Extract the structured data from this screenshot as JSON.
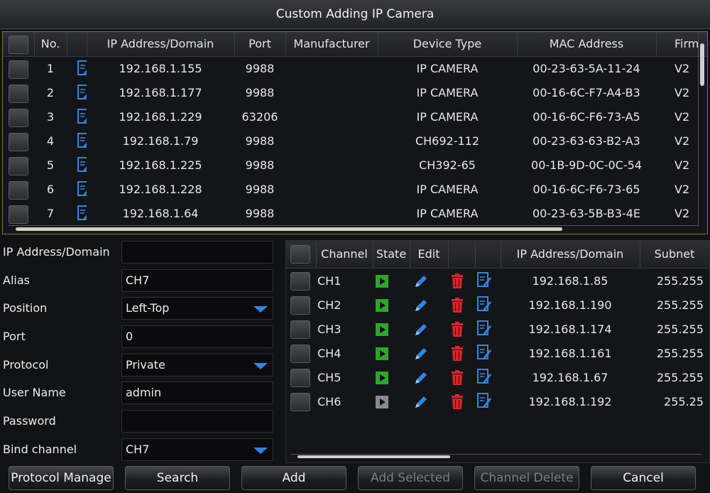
{
  "window": {
    "title": "Custom Adding IP Camera"
  },
  "device_table": {
    "columns": [
      "No.",
      "IP Address/Domain",
      "Port",
      "Manufacturer",
      "Device Type",
      "MAC Address",
      "Firm"
    ],
    "rows": [
      {
        "no": "1",
        "ip": "192.168.1.155",
        "port": "9988",
        "manufacturer": "",
        "type": "IP CAMERA",
        "mac": "00-23-63-5A-11-24",
        "firm": "V2"
      },
      {
        "no": "2",
        "ip": "192.168.1.177",
        "port": "9988",
        "manufacturer": "",
        "type": "IP CAMERA",
        "mac": "00-16-6C-F7-A4-B3",
        "firm": "V2"
      },
      {
        "no": "3",
        "ip": "192.168.1.229",
        "port": "63206",
        "manufacturer": "",
        "type": "IP CAMERA",
        "mac": "00-16-6C-F6-73-A5",
        "firm": "V2"
      },
      {
        "no": "4",
        "ip": "192.168.1.79",
        "port": "9988",
        "manufacturer": "",
        "type": "CH692-112",
        "mac": "00-23-63-63-B2-A3",
        "firm": "V2"
      },
      {
        "no": "5",
        "ip": "192.168.1.225",
        "port": "9988",
        "manufacturer": "",
        "type": "CH392-65",
        "mac": "00-1B-9D-0C-0C-54",
        "firm": "V2"
      },
      {
        "no": "6",
        "ip": "192.168.1.228",
        "port": "9988",
        "manufacturer": "",
        "type": "IP CAMERA",
        "mac": "00-16-6C-F6-73-65",
        "firm": "V2"
      },
      {
        "no": "7",
        "ip": "192.168.1.64",
        "port": "9988",
        "manufacturer": "",
        "type": "IP CAMERA",
        "mac": "00-23-63-5B-B3-4E",
        "firm": "V2"
      }
    ]
  },
  "form": {
    "ip_label": "IP Address/Domain",
    "ip_value": "",
    "alias_label": "Alias",
    "alias_value": "CH7",
    "position_label": "Position",
    "position_value": "Left-Top",
    "port_label": "Port",
    "port_value": "0",
    "protocol_label": "Protocol",
    "protocol_value": "Private",
    "username_label": "User Name",
    "username_value": "admin",
    "password_label": "Password",
    "password_value": "",
    "bind_label": "Bind channel",
    "bind_value": "CH7"
  },
  "channel_table": {
    "columns": {
      "channel": "Channel",
      "state": "State",
      "edit": "Edit",
      "ip": "IP Address/Domain",
      "subnet": "Subnet"
    },
    "rows": [
      {
        "channel": "CH1",
        "ip": "192.168.1.85",
        "subnet": "255.255",
        "state": "active"
      },
      {
        "channel": "CH2",
        "ip": "192.168.1.190",
        "subnet": "255.255",
        "state": "active"
      },
      {
        "channel": "CH3",
        "ip": "192.168.1.174",
        "subnet": "255.255",
        "state": "active"
      },
      {
        "channel": "CH4",
        "ip": "192.168.1.161",
        "subnet": "255.255",
        "state": "active"
      },
      {
        "channel": "CH5",
        "ip": "192.168.1.67",
        "subnet": "255.255",
        "state": "active"
      },
      {
        "channel": "CH6",
        "ip": "192.168.1.192",
        "subnet": "255.25",
        "state": "inactive"
      }
    ]
  },
  "buttons": {
    "protocol_manage": "Protocol Manage",
    "search": "Search",
    "add": "Add",
    "add_selected": "Add Selected",
    "channel_delete": "Channel Delete",
    "cancel": "Cancel"
  },
  "colors": {
    "state_active": "#2fa52f",
    "state_inactive": "#8a8a8a",
    "edit_blue": "#2e86e6",
    "delete_red": "#d8262c",
    "table_border": "#7a7a2a"
  },
  "icons": {
    "edit": "edit-note-icon",
    "pencil": "pencil-icon",
    "delete": "trash-icon",
    "play": "play-icon",
    "dropdown": "chevron-down-icon"
  }
}
